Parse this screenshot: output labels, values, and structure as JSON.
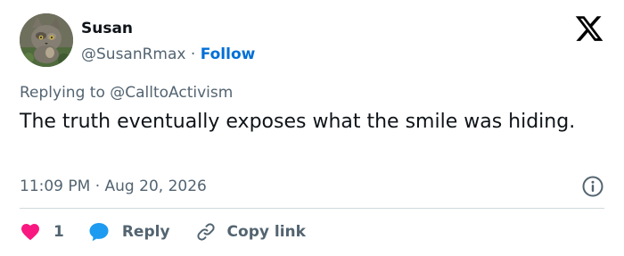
{
  "user": {
    "display_name": "Susan",
    "handle": "@SusanRmax",
    "separator": "·",
    "follow_label": "Follow"
  },
  "reply_context": {
    "prefix": "Replying to",
    "mention": "@CalltoActivism"
  },
  "tweet": {
    "text": "The truth eventually exposes what the smile was hiding."
  },
  "meta": {
    "timestamp": "11:09 PM · Aug 20, 2026"
  },
  "actions": {
    "like_count": "1",
    "reply_label": "Reply",
    "copy_label": "Copy link"
  },
  "icons": {
    "brand": "x-logo-icon",
    "info": "info-icon",
    "like": "heart-icon",
    "reply": "chat-bubble-icon",
    "copy": "link-icon"
  },
  "colors": {
    "text_primary": "#0f1419",
    "text_secondary": "#536471",
    "follow_link": "#006fd6",
    "heart": "#f91880",
    "reply_bubble": "#1d9bf0",
    "divider": "#cfd9de"
  }
}
